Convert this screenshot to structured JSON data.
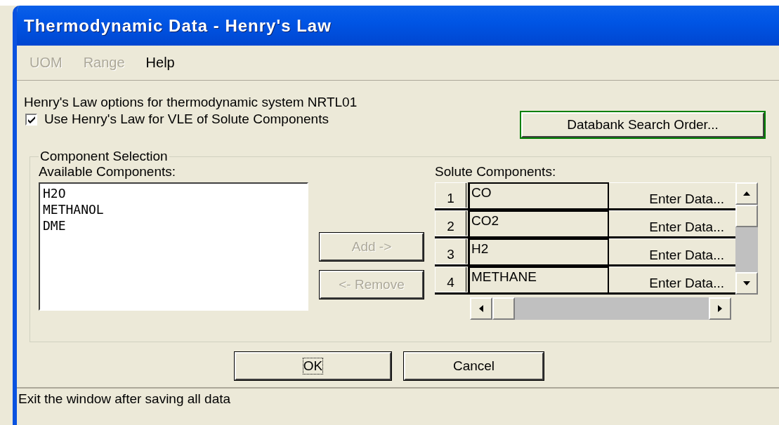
{
  "window": {
    "title": "Thermodynamic Data - Henry's Law"
  },
  "menu": [
    {
      "label": "UOM",
      "disabled": true
    },
    {
      "label": "Range",
      "disabled": true
    },
    {
      "label": "Help",
      "disabled": false
    }
  ],
  "description": "Henry's Law options for thermodynamic system NRTL01",
  "use_henry": {
    "label": "Use Henry's Law for VLE of Solute Components",
    "checked": true
  },
  "databank_button": {
    "label": "Databank Search Order...",
    "default": true
  },
  "group": {
    "title": "Component Selection",
    "available": {
      "label": "Available Components:",
      "items": [
        "H2O",
        "METHANOL",
        "DME"
      ]
    },
    "buttons": [
      {
        "label": "Add ->",
        "disabled": true
      },
      {
        "label": "<- Remove",
        "disabled": true
      }
    ],
    "solute": {
      "label": "Solute Components:",
      "rows": [
        {
          "number": "1",
          "name": "CO",
          "action": "Enter Data..."
        },
        {
          "number": "2",
          "name": "CO2",
          "action": "Enter Data..."
        },
        {
          "number": "3",
          "name": "H2",
          "action": "Enter Data..."
        },
        {
          "number": "4",
          "name": "METHANE",
          "action": "Enter Data..."
        }
      ]
    }
  },
  "footer_buttons": [
    {
      "label": "OK",
      "focused": true
    },
    {
      "label": "Cancel",
      "focused": false
    }
  ],
  "status_bar": "Exit the window after saving all data"
}
